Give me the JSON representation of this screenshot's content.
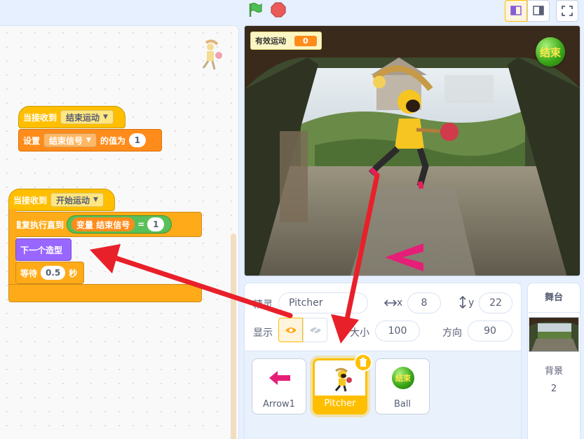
{
  "toolbar": {
    "green_flag": "green-flag",
    "stop": "stop-sign",
    "small_stage": "small-stage-mode",
    "large_stage": "large-stage-mode",
    "fullscreen": "fullscreen"
  },
  "scripts": {
    "script1": {
      "hat_label": "当接收到",
      "hat_message": "结束运动",
      "set_label": "设置",
      "set_variable": "结束信号",
      "set_to_label": "的值为",
      "set_value": "1"
    },
    "script2": {
      "hat_label": "当接收到",
      "hat_message": "开始运动",
      "repeat_label": "重复执行直到",
      "variable_reporter": "变量 结束信号",
      "equals": "=",
      "compare_value": "1",
      "next_costume": "下一个造型",
      "wait_label": "等待",
      "wait_value": "0.5",
      "wait_unit": "秒"
    }
  },
  "stage": {
    "monitor_label": "有效运动",
    "monitor_value": "0",
    "end_sprite_text": "结束"
  },
  "sprite_info": {
    "sprite_label": "精灵",
    "sprite_name": "Pitcher",
    "x_label": "x",
    "x_value": "8",
    "y_label": "y",
    "y_value": "22",
    "show_label": "显示",
    "size_label": "大小",
    "size_value": "100",
    "direction_label": "方向",
    "direction_value": "90"
  },
  "sprites": [
    {
      "name": "Arrow1"
    },
    {
      "name": "Pitcher"
    },
    {
      "name": "Ball",
      "thumb_text": "结束"
    }
  ],
  "stage_pane": {
    "title": "舞台",
    "backdrop_label": "背景",
    "backdrop_count": "2"
  },
  "colors": {
    "accent": "#ffbf00",
    "events": "#ffbf00",
    "variables": "#ff8c1a",
    "control": "#ffab19",
    "looks": "#9966ff",
    "operators": "#59c059",
    "annotation_arrow": "#e8202a"
  }
}
